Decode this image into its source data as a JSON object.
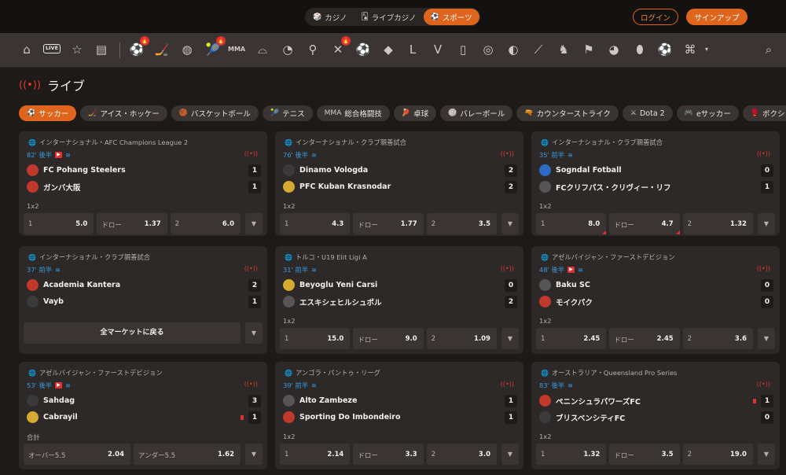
{
  "top": {
    "tabs": [
      {
        "icon": "🎲",
        "label": "カジノ"
      },
      {
        "icon": "🂡",
        "label": "ライブカジノ"
      },
      {
        "icon": "⚽",
        "label": "スポーツ"
      }
    ],
    "login": "ログイン",
    "signup": "サインアップ"
  },
  "iconbar": {
    "live_label": "LIVE",
    "icons": [
      "home",
      "live",
      "star",
      "betslip",
      "soccer",
      "hockey",
      "basketball",
      "tennis",
      "mma",
      "table-tennis",
      "volleyball",
      "counter-strike",
      "dota2",
      "esoccer",
      "boxing",
      "handball",
      "american-football",
      "baseball",
      "valorant",
      "efootball",
      "esports",
      "cricket",
      "rugby",
      "darts",
      "chess",
      "motorsport",
      "ice",
      "cycling",
      "more"
    ]
  },
  "live_title": "ライブ",
  "chips": [
    {
      "icon": "⚽",
      "label": "サッカー"
    },
    {
      "icon": "🏒",
      "label": "アイス・ホッケー"
    },
    {
      "icon": "🏀",
      "label": "バスケットボール"
    },
    {
      "icon": "🎾",
      "label": "テニス"
    },
    {
      "icon": "MMA",
      "label": "総合格闘技"
    },
    {
      "icon": "🏓",
      "label": "卓球"
    },
    {
      "icon": "🏐",
      "label": "バレーボール"
    },
    {
      "icon": "🔫",
      "label": "カウンターストライク"
    },
    {
      "icon": "⚔",
      "label": "Dota 2"
    },
    {
      "icon": "🎮",
      "label": "eサッカー"
    },
    {
      "icon": "🥊",
      "label": "ボクシング"
    }
  ],
  "cards": [
    {
      "league": "インターナショナル・AFC Champions League 2",
      "time": "82' 後半",
      "tv": true,
      "home": "FC Pohang Steelers",
      "away": "ガンバ大阪",
      "home_score": "1",
      "away_score": "1",
      "market": "1x2",
      "odds": [
        {
          "l": "1",
          "v": "5.0"
        },
        {
          "l": "ドロー",
          "v": "1.37"
        },
        {
          "l": "2",
          "v": "6.0"
        }
      ]
    },
    {
      "league": "インターナショナル・クラブ親善試合",
      "time": "76' 後半",
      "tv": false,
      "home": "Dinamo Vologda",
      "away": "PFC Kuban Krasnodar",
      "home_score": "2",
      "away_score": "2",
      "market": "1x2",
      "odds": [
        {
          "l": "1",
          "v": "4.3"
        },
        {
          "l": "ドロー",
          "v": "1.77"
        },
        {
          "l": "2",
          "v": "3.5"
        }
      ]
    },
    {
      "league": "インターナショナル・クラブ親善試合",
      "time": "35' 前半",
      "tv": false,
      "home": "Sogndal Fotball",
      "away": "FCクリフパス・クリヴィー・リフ",
      "home_score": "0",
      "away_score": "1",
      "market": "1x2",
      "odds": [
        {
          "l": "1",
          "v": "8.0"
        },
        {
          "l": "ドロー",
          "v": "4.7"
        },
        {
          "l": "2",
          "v": "1.32"
        }
      ]
    },
    {
      "league": "インターナショナル・クラブ親善試合",
      "time": "37' 前半",
      "tv": false,
      "home": "Academia Kantera",
      "away": "Vayb",
      "home_score": "2",
      "away_score": "1",
      "back": "全マーケットに戻る"
    },
    {
      "league": "トルコ・U19 Elit Ligi A",
      "time": "31' 前半",
      "tv": false,
      "home": "Beyoglu Yeni Carsi",
      "away": "エスキシェヒルシュポル",
      "home_score": "0",
      "away_score": "2",
      "market": "1x2",
      "odds": [
        {
          "l": "1",
          "v": "15.0"
        },
        {
          "l": "ドロー",
          "v": "9.0"
        },
        {
          "l": "2",
          "v": "1.09"
        }
      ]
    },
    {
      "league": "アゼルバイジャン・ファーストデビジョン",
      "time": "48' 後半",
      "tv": true,
      "home": "Baku SC",
      "away": "モイクパク",
      "home_score": "0",
      "away_score": "0",
      "market": "1x2",
      "odds": [
        {
          "l": "1",
          "v": "2.45"
        },
        {
          "l": "ドロー",
          "v": "2.45"
        },
        {
          "l": "2",
          "v": "3.6"
        }
      ]
    },
    {
      "league": "アゼルバイジャン・ファーストデビジョン",
      "time": "53' 後半",
      "tv": true,
      "home": "Sahdag",
      "away": "Cabrayil",
      "home_score": "3",
      "away_score": "1",
      "market": "合計",
      "odds": [
        {
          "l": "オーバー5.5",
          "v": "2.04"
        },
        {
          "l": "アンダー5.5",
          "v": "1.62"
        }
      ]
    },
    {
      "league": "アンゴラ・パントゥ・リーグ",
      "time": "39' 前半",
      "tv": false,
      "home": "Alto Zambeze",
      "away": "Sporting Do Imbondeiro",
      "home_score": "1",
      "away_score": "1",
      "market": "1x2",
      "odds": [
        {
          "l": "1",
          "v": "2.14"
        },
        {
          "l": "ドロー",
          "v": "3.3"
        },
        {
          "l": "2",
          "v": "3.0"
        }
      ]
    },
    {
      "league": "オーストラリア・Queensland Pro Series",
      "time": "83' 後半",
      "tv": false,
      "home": "ペニンシュラパワーズFC",
      "away": "ブリスベンシティFC",
      "home_score": "1",
      "away_score": "0",
      "market": "1x2",
      "odds": [
        {
          "l": "1",
          "v": "1.32"
        },
        {
          "l": "ドロー",
          "v": "3.5"
        },
        {
          "l": "2",
          "v": "19.0"
        }
      ]
    }
  ],
  "colors": {
    "accent": "#e0651c",
    "live": "#e03a2a",
    "time": "#3a9be0",
    "card": "#2d2928"
  }
}
